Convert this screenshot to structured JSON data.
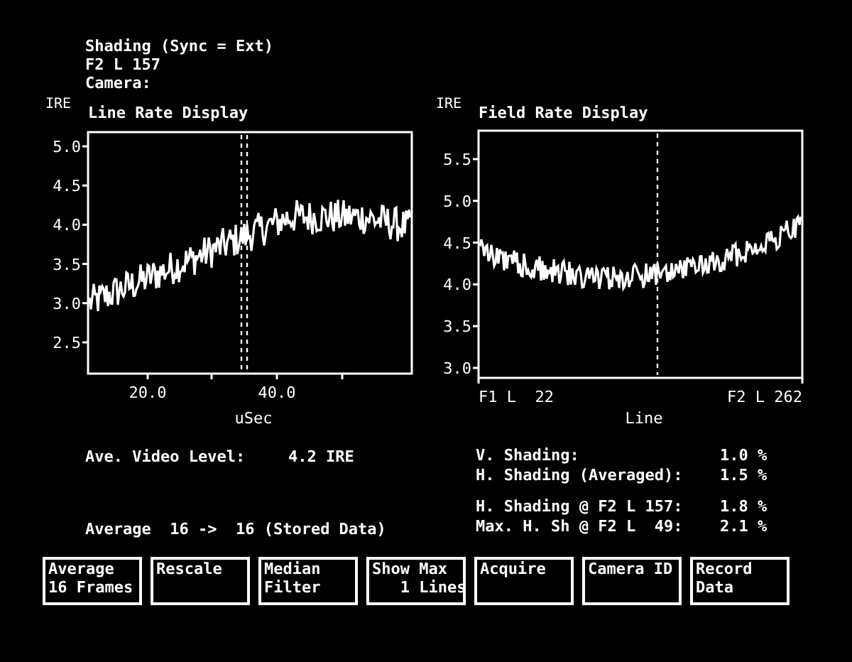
{
  "header": {
    "title": "Shading (Sync = Ext)",
    "position": "F2 L 157",
    "camera_label": "Camera:"
  },
  "charts": [
    {
      "kind": "line_rate",
      "unit": "IRE",
      "title": "Line Rate Display",
      "y_ticks": [
        "5.0",
        "4.5",
        "4.0",
        "3.5",
        "3.0",
        "2.5"
      ],
      "x_ticks": [
        "20.0",
        "40.0"
      ],
      "x_label": "uSec"
    },
    {
      "kind": "field_rate",
      "unit": "IRE",
      "title": "Field Rate Display",
      "y_ticks": [
        "5.5",
        "5.0",
        "4.5",
        "4.0",
        "3.5",
        "3.0"
      ],
      "x_ticks": [
        "F1 L  22",
        "F2 L 262"
      ],
      "x_label": "Line"
    }
  ],
  "video_level": {
    "label": "Ave. Video Level:",
    "value": "4.2 IRE"
  },
  "average_status": "Average  16 ->  16 (Stored Data)",
  "shading_groups": [
    [
      {
        "label": "V. Shading:",
        "value": "1.0 %"
      },
      {
        "label": "H. Shading (Averaged):",
        "value": "1.5 %"
      }
    ],
    [
      {
        "label": "H. Shading @ F2 L 157:",
        "value": "1.8 %"
      },
      {
        "label": "Max. H. Sh @ F2 L  49:",
        "value": "2.1 %"
      }
    ]
  ],
  "buttons": [
    "Average\n16 Frames",
    "Rescale",
    "Median\nFilter",
    "Show Max\n   1 Lines",
    "Acquire",
    "Camera ID",
    "Record\nData"
  ]
}
